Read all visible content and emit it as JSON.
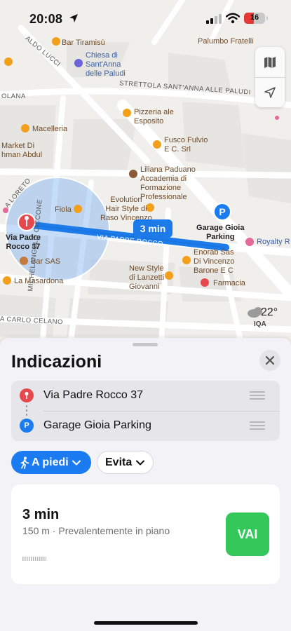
{
  "status_bar": {
    "time": "20:08",
    "battery": "16"
  },
  "map": {
    "labels": {
      "bar_tiramisu": "Bar Tiramisù",
      "palumbo": "Palumbo Fratelli",
      "aldo_lucci": "ALDO LUCCI",
      "chiesa": "Chiesa di\nSant'Anna\ndelle Paludi",
      "strettola": "STRETTOLA SANT'ANNA ALLE PALUDI",
      "olana": "OLANA",
      "pizzeria": "Pizzeria ale\nEsposito",
      "macelleria": "Macelleria",
      "fusco": "Fusco Fulvio\nE C. Srl",
      "market": "Market Di\nhman Abdul",
      "liliana": "Liliana Paduano\nAccademia di\nFormazione\nProfessionale",
      "loreto": "A LORETO",
      "evolution": "Evolution\nHair Style di\nRaso Vincenzo",
      "fiola": "Fiola",
      "via_padre_rocco_street": "VIA PADRE ROCCO",
      "start_pin": "Via Padre\nRocco 37",
      "end_pin": "Garage Gioia\nParking",
      "royalty": "Royalty R",
      "enorab": "Enorab Sas\nDi Vincenzo\nBarone E C",
      "bar_sas": "Bar SAS",
      "new_style": "New Style\ndi Lanzetti\nGiovanni",
      "farmacia": "Farmacia",
      "la_masardona": "La Masardona",
      "carlo_celano": "A CARLO CELANO",
      "michelangelo": "MICHELANGELO CICCONE"
    },
    "route_time": "3 min",
    "weather": {
      "temperature": "22°",
      "air_quality": "IQA"
    }
  },
  "sheet": {
    "title": "Indicazioni",
    "stops": [
      {
        "label": "Via Padre Rocco 37",
        "icon": "pin-icon",
        "color": "#e5484d"
      },
      {
        "label": "Garage Gioia Parking",
        "icon": "parking-icon",
        "icon_text": "P",
        "color": "#1a7cf0"
      }
    ],
    "transport_mode": "A piedi",
    "avoid": "Evita",
    "route": {
      "duration": "3 min",
      "detail": "150 m · Prevalentemente in piano",
      "go": "VAI"
    }
  },
  "colors": {
    "accent": "#1a7cf0",
    "go": "#34c759",
    "route_line": "#1c7be8"
  }
}
